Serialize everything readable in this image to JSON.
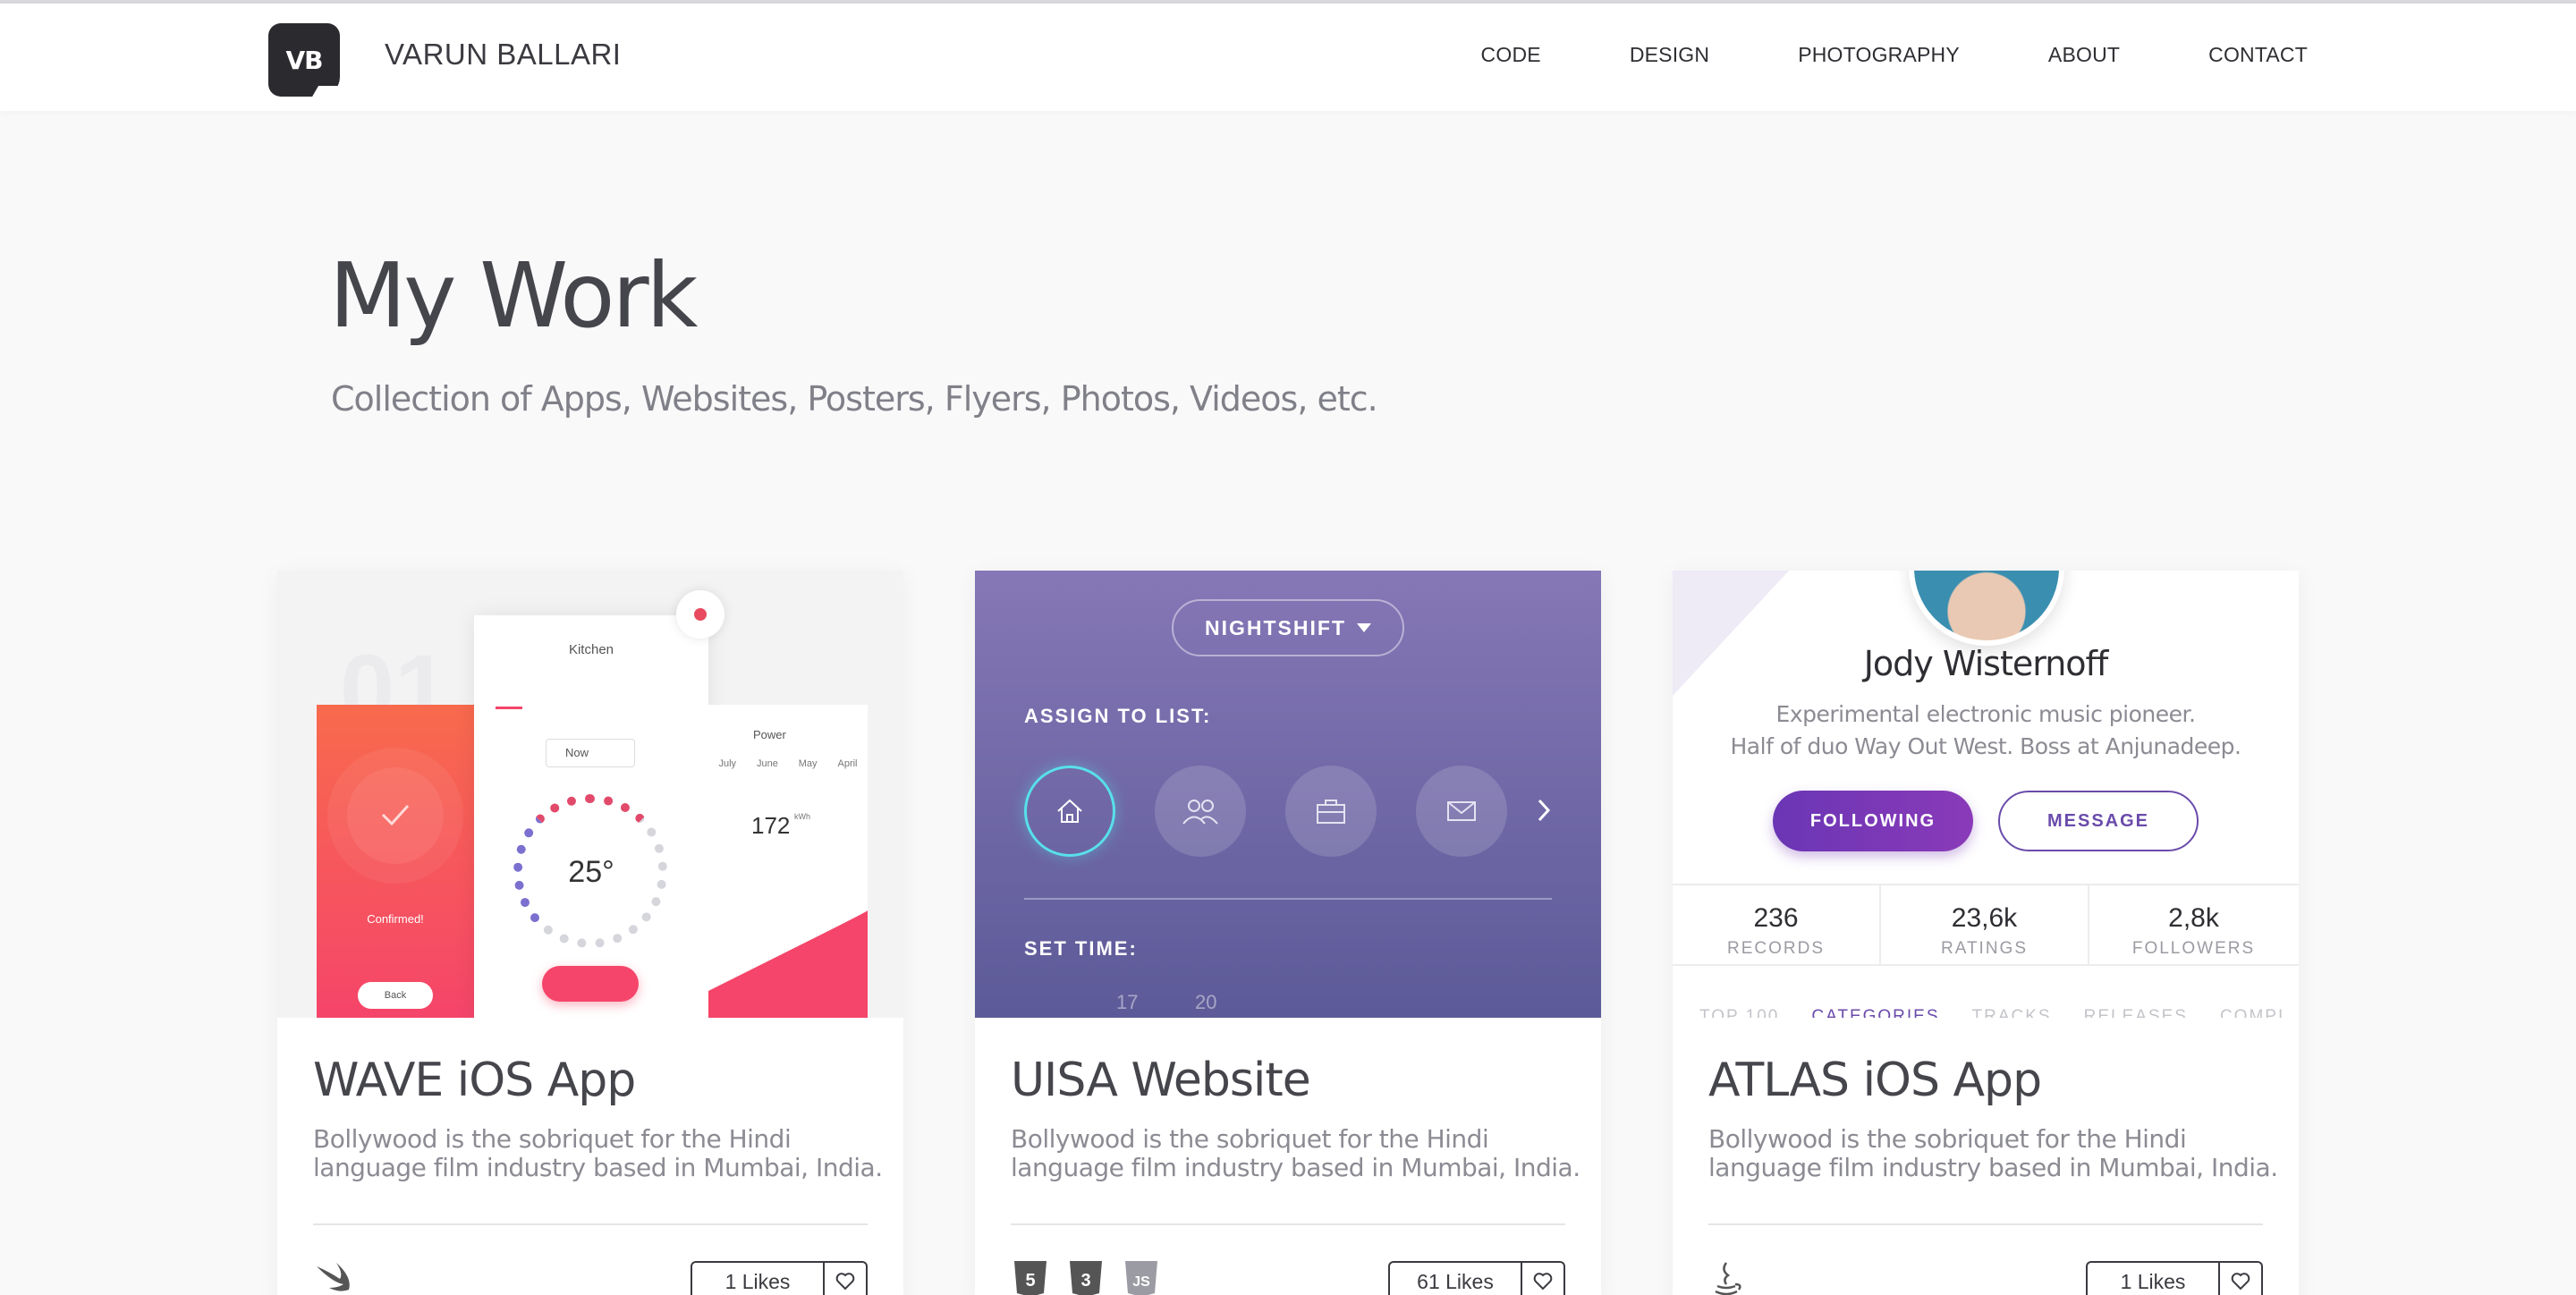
{
  "nav": {
    "logo": "VB",
    "brand": "VARUN BALLARI",
    "items": [
      "CODE",
      "DESIGN",
      "PHOTOGRAPHY",
      "ABOUT",
      "CONTACT"
    ]
  },
  "header": {
    "title": "My Work",
    "subtitle": "Collection of Apps, Websites, Posters, Flyers, Photos, Videos, etc."
  },
  "cards": [
    {
      "title": "WAVE iOS App",
      "description": "Bollywood is the sobriquet for the Hindi language film industry based in Mumbai, India.",
      "likes": "1 Likes",
      "tech_icons": [
        "swift-icon"
      ],
      "thumb": {
        "number": "01",
        "kitchen": "Kitchen",
        "now": "Now",
        "temp": "25°",
        "confirmed": "Confirmed!",
        "back": "Back",
        "power": "Power",
        "months": [
          "July",
          "June",
          "May",
          "April"
        ],
        "kwh": "172",
        "kwh_unit": "kWh"
      }
    },
    {
      "title": "UISA Website",
      "description": "Bollywood is the sobriquet for the Hindi language film industry based in Mumbai, India.",
      "likes": "61 Likes",
      "tech_icons": [
        "html5-icon",
        "css3-icon",
        "js-icon"
      ],
      "thumb": {
        "pill": "NIGHTSHIFT",
        "assign": "ASSIGN TO LIST:",
        "set_time": "SET TIME:",
        "times": [
          "17",
          "20"
        ]
      }
    },
    {
      "title": "ATLAS iOS App",
      "description": "Bollywood is the sobriquet for the Hindi language film industry based in Mumbai, India.",
      "likes": "1 Likes",
      "tech_icons": [
        "java-icon"
      ],
      "thumb": {
        "name": "Jody Wisternoff",
        "bio1": "Experimental electronic music pioneer.",
        "bio2": "Half of duo Way Out West. Boss at Anjunadeep.",
        "following": "FOLLOWING",
        "message": "MESSAGE",
        "stats": [
          {
            "value": "236",
            "label": "RECORDS"
          },
          {
            "value": "23,6k",
            "label": "RATINGS"
          },
          {
            "value": "2,8k",
            "label": "FOLLOWERS"
          }
        ],
        "tabs": [
          "TOP 100",
          "CATEGORIES",
          "TRACKS",
          "RELEASES",
          "COMPI"
        ]
      }
    }
  ],
  "colors": {
    "accent_purple": "#7a3ab8",
    "wave_red": "#f5456a",
    "uisa_purple": "#7468ae",
    "highlight_cyan": "#58e0ea"
  }
}
